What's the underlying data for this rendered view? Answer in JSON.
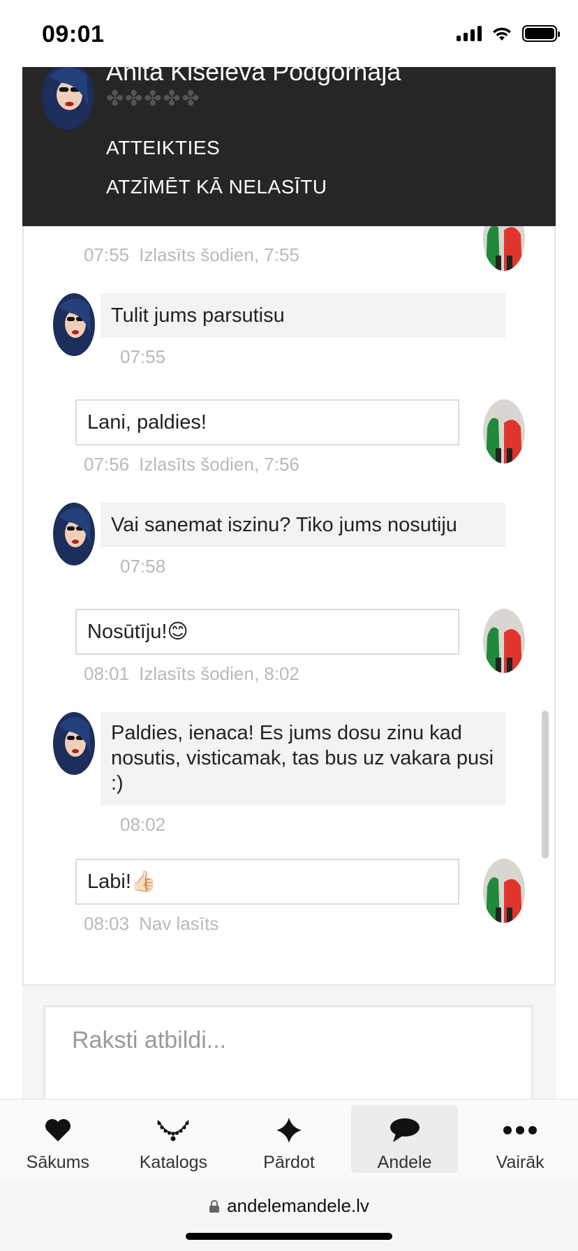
{
  "status_bar": {
    "time": "09:01"
  },
  "header": {
    "user_name": "Anita Kiseleva Podgornaja",
    "rating_stars": "✤✤✤✤✤",
    "menu": [
      "ATTEIKTIES",
      "ATZĪMĒT KĀ NELASĪTU"
    ]
  },
  "messages": [
    {
      "direction": "outgoing",
      "text": "",
      "time": "07:55",
      "status": "Izlasīts šodien, 7:55"
    },
    {
      "direction": "incoming",
      "text": "Tulit jums parsutisu",
      "time": "07:55"
    },
    {
      "direction": "outgoing",
      "text": "Lani, paldies!",
      "time": "07:56",
      "status": "Izlasīts šodien, 7:56"
    },
    {
      "direction": "incoming",
      "text": "Vai sanemat iszinu? Tiko jums nosutiju",
      "time": "07:58"
    },
    {
      "direction": "outgoing",
      "text": "Nosūtīju!😊",
      "time": "08:01",
      "status": "Izlasīts šodien, 8:02"
    },
    {
      "direction": "incoming",
      "text": "Paldies, ienaca! Es jums dosu zinu kad nosutis, visticamak, tas bus uz vakara pusi :)",
      "time": "08:02"
    },
    {
      "direction": "outgoing",
      "text": "Labi!👍🏻",
      "time": "08:03",
      "status": "Nav lasīts"
    }
  ],
  "reply": {
    "placeholder": "Raksti atbildi..."
  },
  "bottom_nav": {
    "active": "Andele",
    "items": [
      {
        "label": "Sākums",
        "icon": "heart-icon"
      },
      {
        "label": "Katalogs",
        "icon": "necklace-icon"
      },
      {
        "label": "Pārdot",
        "icon": "diamond-cross-icon"
      },
      {
        "label": "Andele",
        "icon": "chat-bubble-icon"
      },
      {
        "label": "Vairāk",
        "icon": "more-dots-icon"
      }
    ]
  },
  "browser": {
    "url": "andelemandele.lv"
  },
  "colors": {
    "header_bg": "#262626",
    "incoming_bubble": "#f3f3f3",
    "outgoing_border": "#dadada",
    "meta_text": "#b9b9b9"
  }
}
